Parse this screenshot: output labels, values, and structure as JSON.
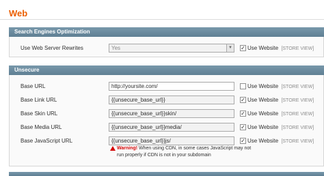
{
  "page": {
    "title": "Web"
  },
  "search_engines": {
    "header": "Search Engines Optimization",
    "rewrites": {
      "label": "Use Web Server Rewrites",
      "value": "Yes",
      "use_website_checked": true,
      "use_website_label": "Use Website",
      "scope": "[STORE VIEW]"
    }
  },
  "unsecure": {
    "header": "Unsecure",
    "use_website_label": "Use Website",
    "scope": "[STORE VIEW]",
    "fields": [
      {
        "label": "Base URL",
        "value": "http://yoursite.com/",
        "use_website_checked": false
      },
      {
        "label": "Base Link URL",
        "value": "{{unsecure_base_url}}",
        "use_website_checked": true
      },
      {
        "label": "Base Skin URL",
        "value": "{{unsecure_base_url}}skin/",
        "use_website_checked": true
      },
      {
        "label": "Base Media URL",
        "value": "{{unsecure_base_url}}media/",
        "use_website_checked": true
      },
      {
        "label": "Base JavaScript URL",
        "value": "{{unsecure_base_url}}js/",
        "use_website_checked": true
      }
    ],
    "warning": {
      "strong": "Warning!",
      "text": "When using CDN, in some cases JavaScript may not run properly if CDN is not in your subdomain"
    }
  },
  "checkmark_glyph": "✓",
  "accent_color": "#eb5e00",
  "header_color": "#6a8a9e"
}
